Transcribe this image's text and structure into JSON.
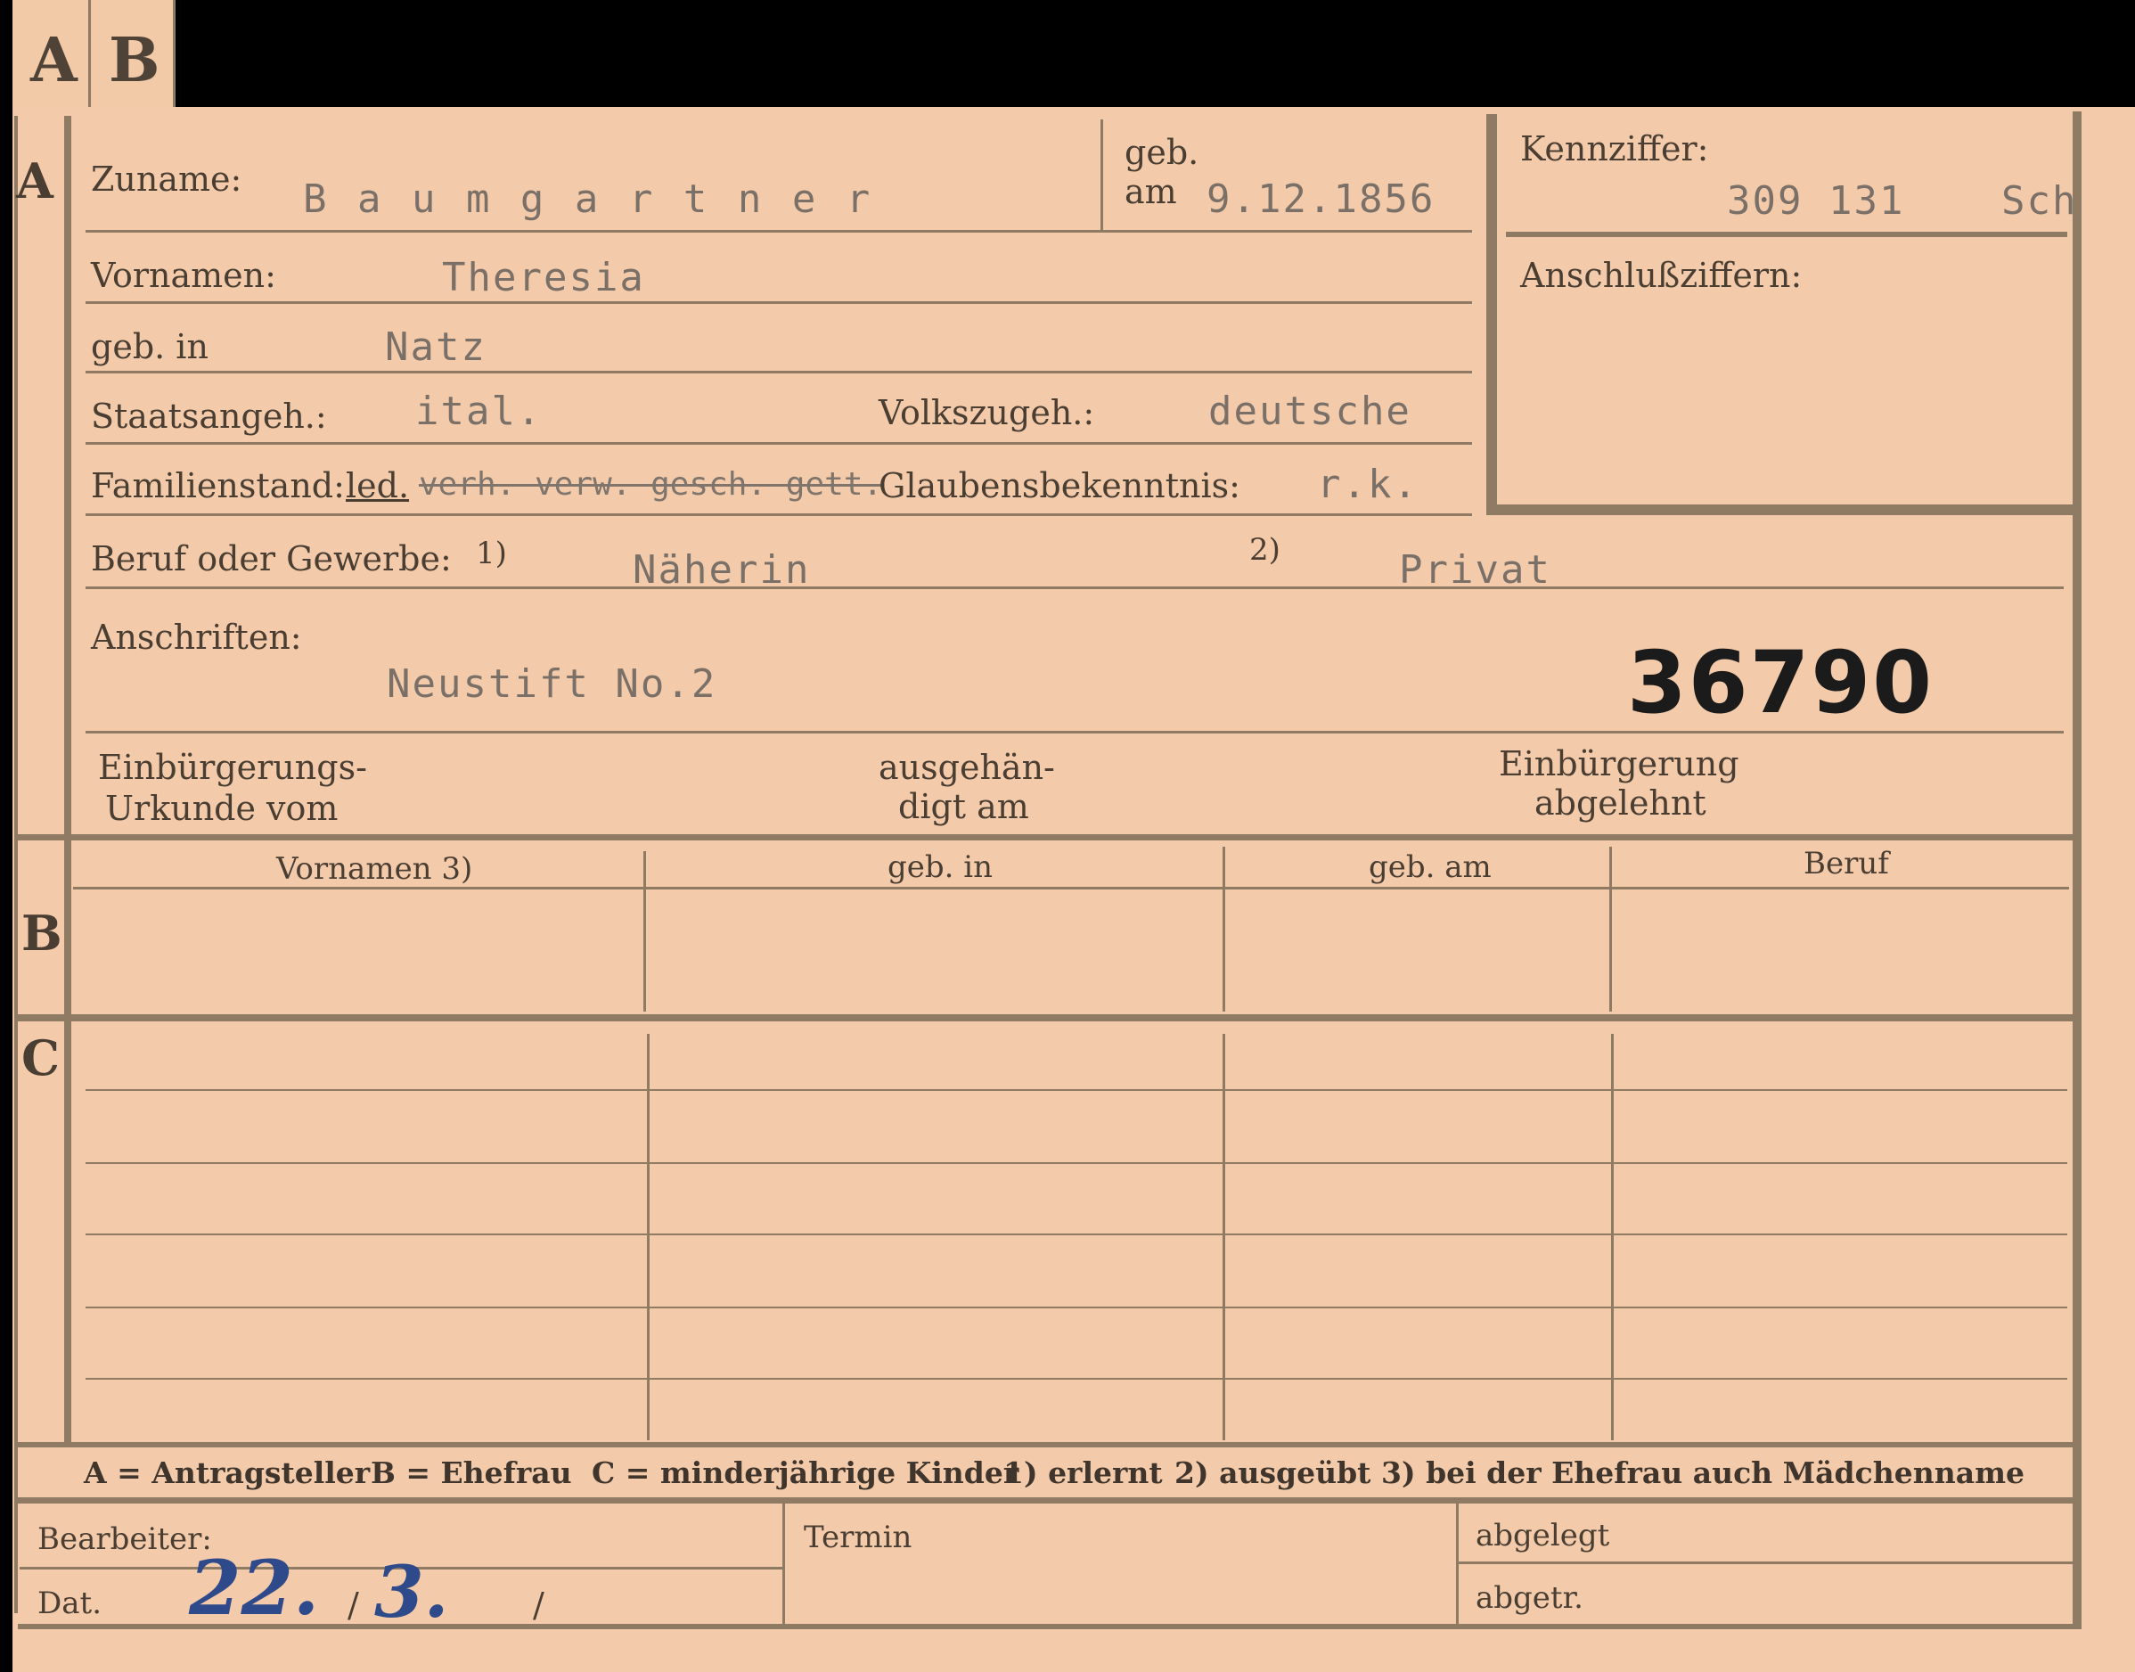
{
  "tabs": [
    "A",
    "B"
  ],
  "sections": {
    "a": "A",
    "b": "B",
    "c": "C"
  },
  "section_a": {
    "zuname_label": "Zuname:",
    "zuname_value": "B a u m g a r t n e r",
    "geb_label": "geb.",
    "am_label": "am",
    "geb_am_value": "9.12.1856",
    "kennziffer_label": "Kennziffer:",
    "kennziffer_value": "309 131",
    "kennziffer_suffix": "Sch",
    "vornamen_label": "Vornamen:",
    "vornamen_value": "Theresia",
    "anschluss_label": "Anschlußziffern:",
    "geb_in_label": "geb. in",
    "geb_in_value": "Natz",
    "staatsangeh_label": "Staatsangeh.:",
    "staatsangeh_value": "ital.",
    "volkszugeh_label": "Volkszugeh.:",
    "volkszugeh_value": "deutsche",
    "familienstand_label": "Familienstand:",
    "familienstand_value": "led.",
    "familienstand_struck": "verh. verw. gesch. gett.",
    "glauben_label": "Glaubensbekenntnis:",
    "glauben_value": "r.k.",
    "beruf_label": "Beruf oder Gewerbe:",
    "beruf_note1": "1)",
    "beruf_value1": "Näherin",
    "beruf_note2": "2)",
    "beruf_value2": "Privat",
    "anschriften_label": "Anschriften:",
    "anschriften_value": "Neustift No.2",
    "stamp_number": "36790",
    "einb_urkunde_label1": "Einbürgerungs-",
    "einb_urkunde_label2": "Urkunde vom",
    "ausgeh_label1": "ausgehän-",
    "ausgeh_label2": "digt am",
    "einb_abgelehnt_label1": "Einbürgerung",
    "einb_abgelehnt_label2": "abgelehnt"
  },
  "section_b": {
    "columns": [
      "Vornamen 3)",
      "geb. in",
      "geb. am",
      "Beruf"
    ]
  },
  "legend": {
    "a": "A = Antragsteller",
    "b": "B = Ehefrau",
    "c": "C = minderjährige Kinder",
    "n1": "1) erlernt",
    "n2": "2) ausgeübt",
    "n3": "3) bei der Ehefrau auch Mädchenname"
  },
  "footer": {
    "bearbeiter_label": "Bearbeiter:",
    "dat_label": "Dat.",
    "dat_day": "22.",
    "dat_month": "3.",
    "dat_slash1": "/",
    "dat_slash2": "/",
    "termin_label": "Termin",
    "abgelegt_label": "abgelegt",
    "abgetr_label": "abgetr."
  }
}
